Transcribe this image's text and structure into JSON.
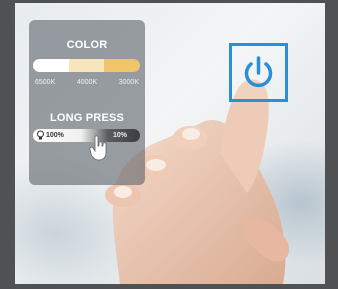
{
  "color_panel": {
    "title": "COLOR",
    "segments": [
      "#ffffff",
      "#f7e6bd",
      "#f0c56a"
    ],
    "labels": [
      "6500K",
      "4000K",
      "3000K"
    ]
  },
  "long_press_panel": {
    "title": "LONG PRESS",
    "brightness_max": "100%",
    "brightness_min": "10%"
  },
  "icons": [
    "bulb-icon",
    "pointer-hand-icon",
    "power-icon"
  ],
  "colors": {
    "accent": "#2b8fd6",
    "panel": "#5f666c"
  }
}
